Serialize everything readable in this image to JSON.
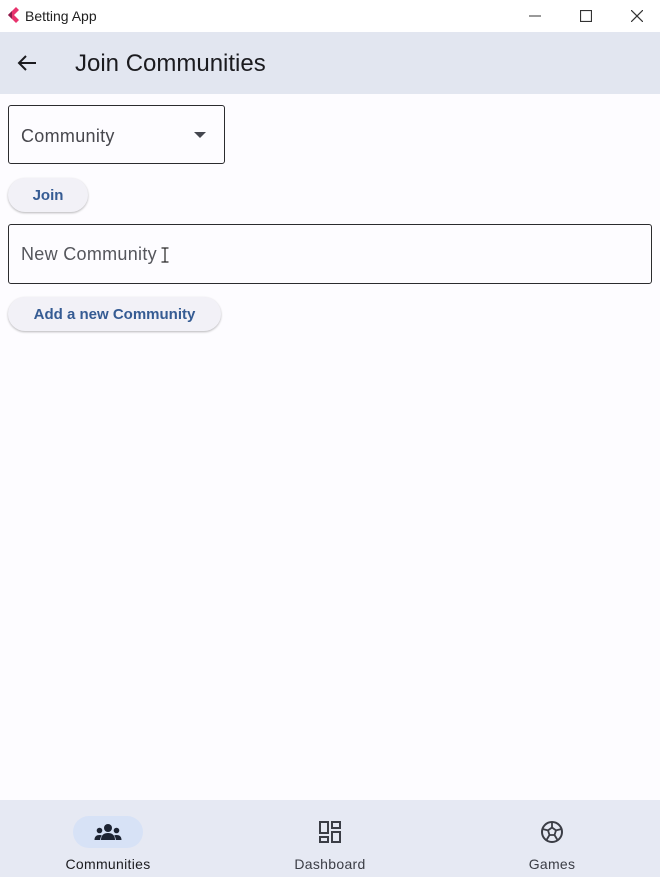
{
  "window": {
    "title": "Betting App"
  },
  "appbar": {
    "title": "Join Communities"
  },
  "dropdown": {
    "label": "Community"
  },
  "join_button": {
    "label": "Join"
  },
  "new_community": {
    "placeholder": "New Community"
  },
  "add_button": {
    "label": "Add a new Community"
  },
  "bottom_nav": {
    "items": [
      {
        "label": "Communities",
        "icon": "groups-icon",
        "selected": true
      },
      {
        "label": "Dashboard",
        "icon": "dashboard-icon",
        "selected": false
      },
      {
        "label": "Games",
        "icon": "soccer-ball-icon",
        "selected": false
      }
    ]
  },
  "colors": {
    "accent": "#355b93",
    "appbar": "#e2e6f0",
    "nav_indicator": "#d7e2f6"
  }
}
